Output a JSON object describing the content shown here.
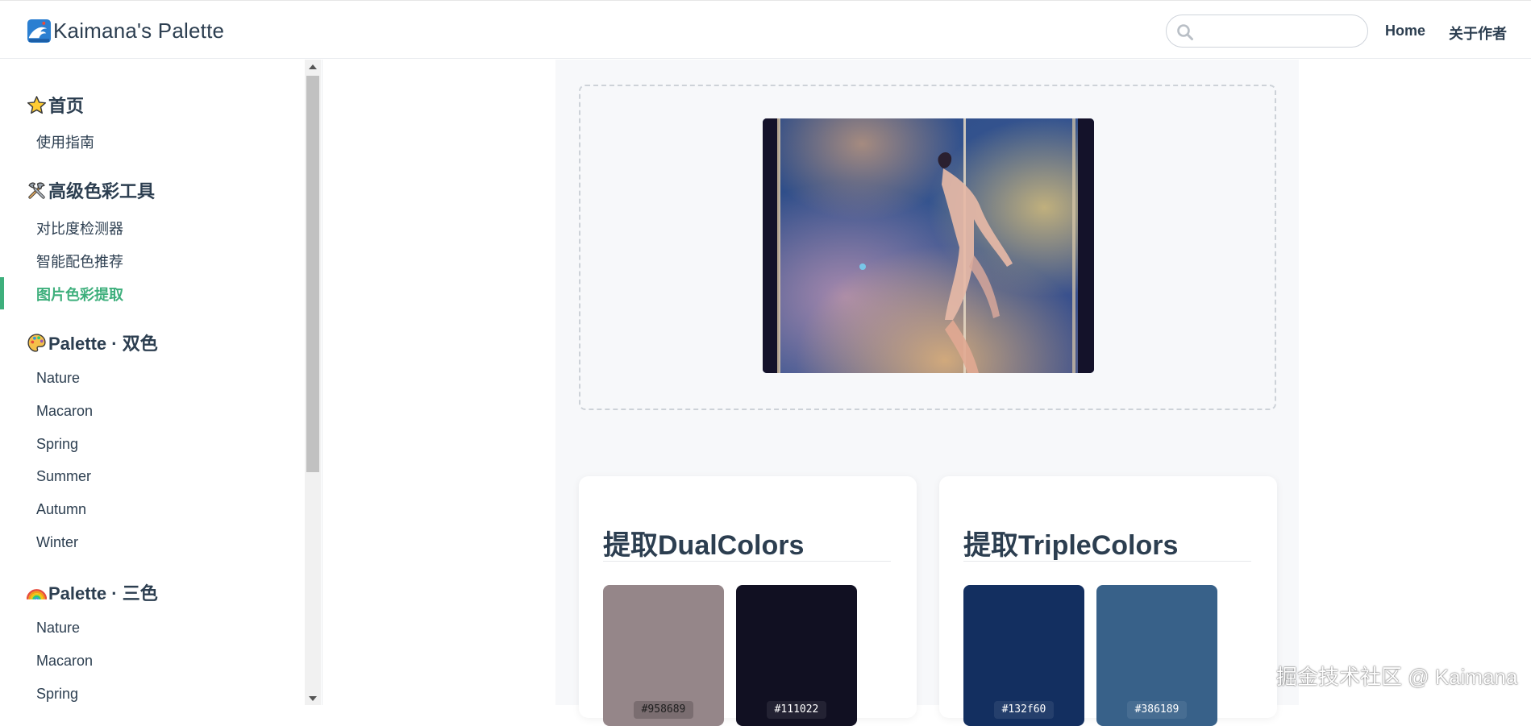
{
  "app": {
    "title": "Kaimana's Palette",
    "logo_icon": "wave-icon"
  },
  "navbar": {
    "search_placeholder": "",
    "links": [
      "Home",
      "关于作者"
    ]
  },
  "sidebar": {
    "groups": [
      {
        "title": "首页",
        "icon": "star-icon",
        "items": [
          "使用指南"
        ]
      },
      {
        "title": "高级色彩工具",
        "icon": "tools-icon",
        "items": [
          "对比度检测器",
          "智能配色推荐",
          "图片色彩提取"
        ]
      },
      {
        "title": "Palette · 双色",
        "icon": "palette-icon",
        "items": [
          "Nature",
          "Macaron",
          "Spring",
          "Summer",
          "Autumn",
          "Winter"
        ]
      },
      {
        "title": "Palette · 三色",
        "icon": "rainbow-icon",
        "items": [
          "Nature",
          "Macaron",
          "Spring"
        ]
      }
    ],
    "active_item": "图片色彩提取"
  },
  "main": {
    "dual": {
      "title": "提取DualColors",
      "colors": [
        "#958689",
        "#111022"
      ]
    },
    "triple": {
      "title": "提取TripleColors",
      "colors": [
        "#132f60",
        "#386189"
      ]
    }
  },
  "colors": {
    "accent": "#3eaf7c",
    "text": "#2c3e50",
    "panel_bg": "#f7f8fa"
  },
  "watermark": "掘金技术社区 @ Kaimana"
}
